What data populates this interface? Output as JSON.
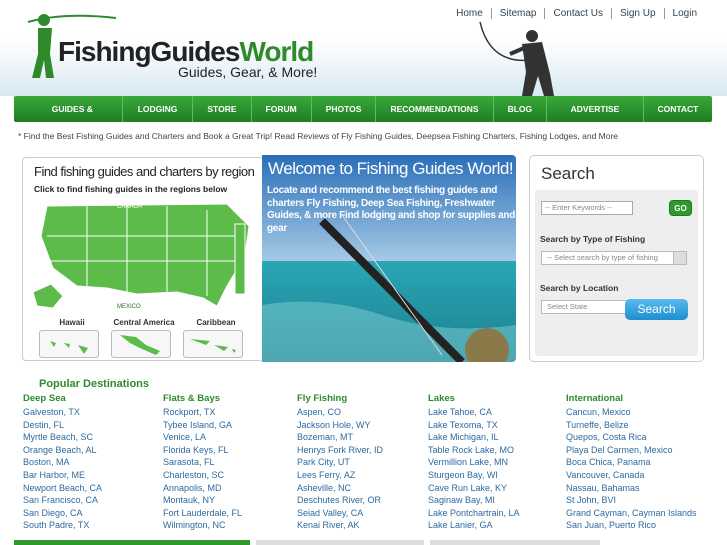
{
  "header": {
    "logo_main_a": "FishingGuides",
    "logo_main_b": "World",
    "logo_tagline": "Guides, Gear, & More!",
    "top_links": [
      "Home",
      "Sitemap",
      "Contact Us",
      "Sign Up",
      "Login"
    ]
  },
  "nav": {
    "items": [
      "GUIDES & CHARTERS",
      "LODGING",
      "STORE",
      "FORUM",
      "PHOTOS",
      "RECOMMENDATIONS",
      "BLOG",
      "ADVERTISE WITH US",
      "CONTACT US"
    ]
  },
  "tagline": "* Find the Best Fishing Guides and Charters and Book a Great Trip! Read Reviews of Fly Fishing Guides, Deepsea Fishing Charters, Fishing Lodges, and More",
  "map_panel": {
    "title": "Find fishing guides and charters by region",
    "subtitle": "Click to find fishing guides in the regions below",
    "map_labels": [
      "CANADA",
      "MEXICO"
    ],
    "regions": [
      "Hawaii",
      "Central America",
      "Caribbean"
    ]
  },
  "banner": {
    "title": "Welcome to Fishing Guides World!",
    "text": "Locate and recommend the best fishing guides and charters Fly Fishing, Deep Sea Fishing, Freshwater Guides, & more Find lodging and shop for supplies and gear"
  },
  "search": {
    "title": "Search",
    "keywords_placeholder": "-- Enter Keywords --",
    "go_label": "GO",
    "type_label": "Search by Type of Fishing",
    "type_select": "-- Select search by type of fishing",
    "location_label": "Search by Location",
    "location_select": "Select State",
    "button_label": "Search"
  },
  "popular": {
    "title": "Popular Destinations",
    "columns": [
      {
        "heading": "Deep Sea",
        "items": [
          "Galveston, TX",
          "Destin, FL",
          "Myrtle Beach, SC",
          "Orange Beach, AL",
          "Boston, MA",
          "Bar Harbor, ME",
          "Newport Beach, CA",
          "San Francisco, CA",
          "San Diego, CA",
          "South Padre, TX"
        ]
      },
      {
        "heading": "Flats & Bays",
        "items": [
          "Rockport, TX",
          "Tybee Island, GA",
          "Venice, LA",
          "Florida Keys, FL",
          "Sarasota, FL",
          "Charleston, SC",
          "Annapolis, MD",
          "Montauk, NY",
          "Fort Lauderdale, FL",
          "Wilmington, NC"
        ]
      },
      {
        "heading": "Fly Fishing",
        "items": [
          "Aspen, CO",
          "Jackson Hole, WY",
          "Bozeman, MT",
          "Henrys Fork River, ID",
          "Park City, UT",
          "Lees Ferry, AZ",
          "Asheville, NC",
          "Deschutes River, OR",
          "Seiad Valley, CA",
          "Kenai River, AK"
        ]
      },
      {
        "heading": "Lakes",
        "items": [
          "Lake Tahoe, CA",
          "Lake Texoma, TX",
          "Lake Michigan, IL",
          "Table Rock Lake, MO",
          "Vermillion Lake, MN",
          "Sturgeon Bay, WI",
          "Cave Run Lake, KY",
          "Saginaw Bay, MI",
          "Lake Pontchartrain, LA",
          "Lake Lanier, GA"
        ]
      },
      {
        "heading": "International",
        "items": [
          "Cancun, Mexico",
          "Turneffe, Belize",
          "Quepos, Costa Rica",
          "Playa Del Carmen, Mexico",
          "Boca Chica, Panama",
          "Vancouver, Canada",
          "Nassau, Bahamas",
          "St John, BVI",
          "Grand Cayman, Cayman Islands",
          "San Juan, Puerto Rico"
        ]
      }
    ]
  }
}
